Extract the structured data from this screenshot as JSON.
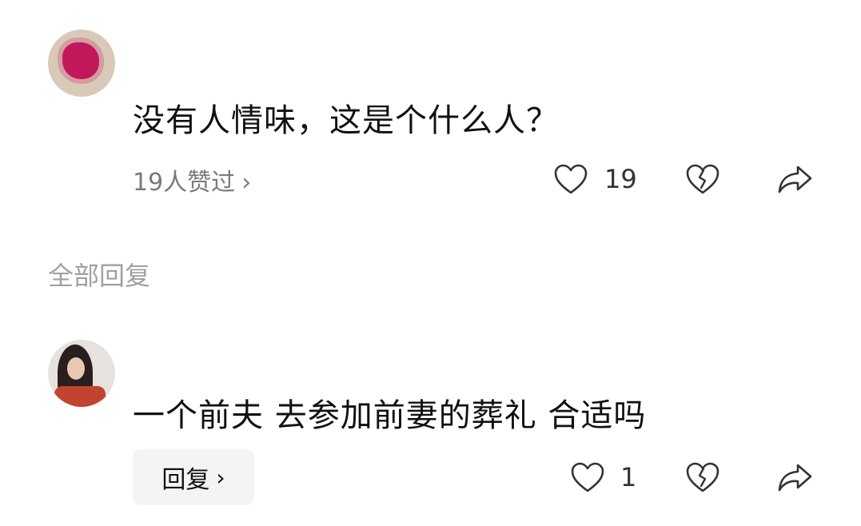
{
  "comments": [
    {
      "meta": [
        "",
        "",
        ""
      ],
      "text": "没有人情味，这是个什么人？",
      "likes_link": "19人赞过",
      "chevron": "›",
      "like_count": "19",
      "icons": [
        "heart-icon",
        "broken-heart-icon",
        "share-icon"
      ]
    },
    {
      "meta": [
        "",
        "",
        ""
      ],
      "text": "一个前夫 去参加前妻的葬礼 合适吗",
      "reply_label": "回复",
      "chevron": "›",
      "like_count": "1",
      "icons": [
        "heart-icon",
        "broken-heart-icon",
        "share-icon"
      ]
    }
  ],
  "section": {
    "all_replies": "全部回复"
  },
  "colors": {
    "text": "#111111",
    "muted": "#7a7a7a",
    "section": "#a0a0a0",
    "reply_bg": "#f4f4f4"
  }
}
